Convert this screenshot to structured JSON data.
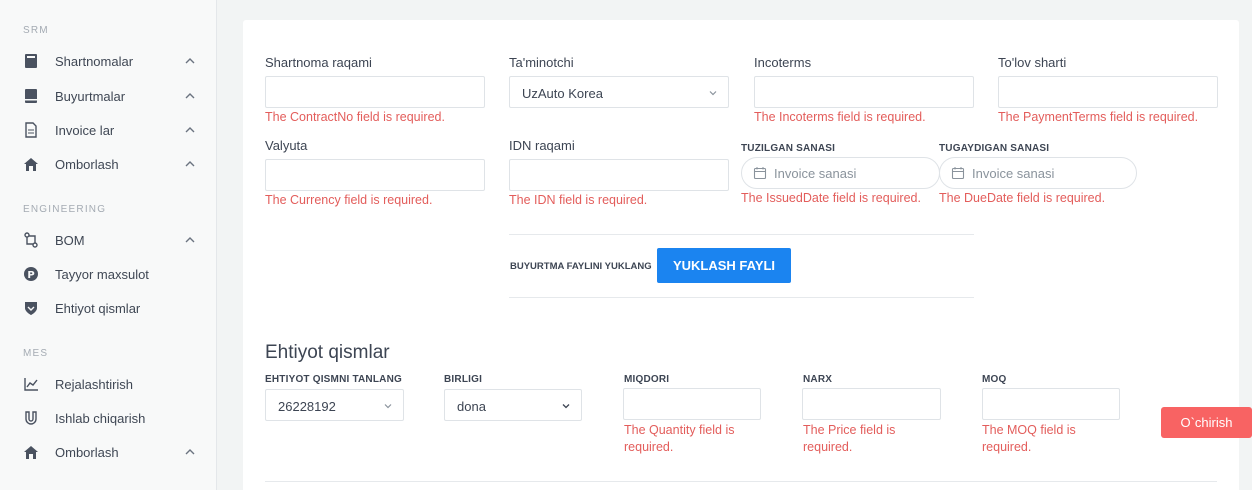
{
  "sidebar": {
    "sections": [
      {
        "title": "SRM"
      },
      {
        "title": "ENGINEERING"
      },
      {
        "title": "MES"
      }
    ],
    "items": [
      {
        "label": "Shartnomalar",
        "icon": "book-icon"
      },
      {
        "label": "Buyurtmalar",
        "icon": "book-icon"
      },
      {
        "label": "Invoice lar",
        "icon": "document-icon"
      },
      {
        "label": "Omborlash",
        "icon": "home-icon"
      },
      {
        "label": "BOM",
        "icon": "flow-icon"
      },
      {
        "label": "Tayyor maxsulot",
        "icon": "product-icon"
      },
      {
        "label": "Ehtiyot qismlar",
        "icon": "shield-icon"
      },
      {
        "label": "Rejalashtirish",
        "icon": "chart-icon"
      },
      {
        "label": "Ishlab chiqarish",
        "icon": "magnet-icon"
      },
      {
        "label": "Omborlash",
        "icon": "home-icon"
      }
    ]
  },
  "form": {
    "contract_no": {
      "label": "Shartnoma raqami",
      "value": "",
      "error": "The ContractNo field is required."
    },
    "supplier": {
      "label": "Ta'minotchi",
      "value": "UzAuto Korea"
    },
    "incoterms": {
      "label": "Incoterms",
      "value": "",
      "error": "The Incoterms field is required."
    },
    "payment_terms": {
      "label": "To'lov sharti",
      "value": "",
      "error": "The PaymentTerms field is required."
    },
    "currency": {
      "label": "Valyuta",
      "value": "",
      "error": "The Currency field is required."
    },
    "idn": {
      "label": "IDN raqami",
      "value": "",
      "error": "The IDN field is required."
    },
    "issued_date": {
      "label": "TUZILGAN SANASI",
      "placeholder": "Invoice sanasi",
      "error": "The IssuedDate field is required."
    },
    "due_date": {
      "label": "TUGAYDIGAN SANASI",
      "placeholder": "Invoice sanasi",
      "error": "The DueDate field is required."
    },
    "upload": {
      "label": "BUYURTMA FAYLINI YUKLANG",
      "button": "YUKLASH FAYLI"
    }
  },
  "parts": {
    "heading": "Ehtiyot qismlar",
    "part_select": {
      "label": "EHTIYOT QISMNI TANLANG",
      "value": "26228192"
    },
    "unit_select": {
      "label": "BIRLIGI",
      "value": "dona"
    },
    "quantity": {
      "label": "MIQDORI",
      "value": "",
      "error": "The Quantity field is required."
    },
    "price": {
      "label": "NARX",
      "value": "",
      "error": "The Price field is required."
    },
    "moq": {
      "label": "MOQ",
      "value": "",
      "error": "The MOQ field is required."
    },
    "delete_button": "O`chirish"
  },
  "colors": {
    "accent": "#1b84f0",
    "error": "#e35d5b",
    "danger": "#f86363"
  }
}
